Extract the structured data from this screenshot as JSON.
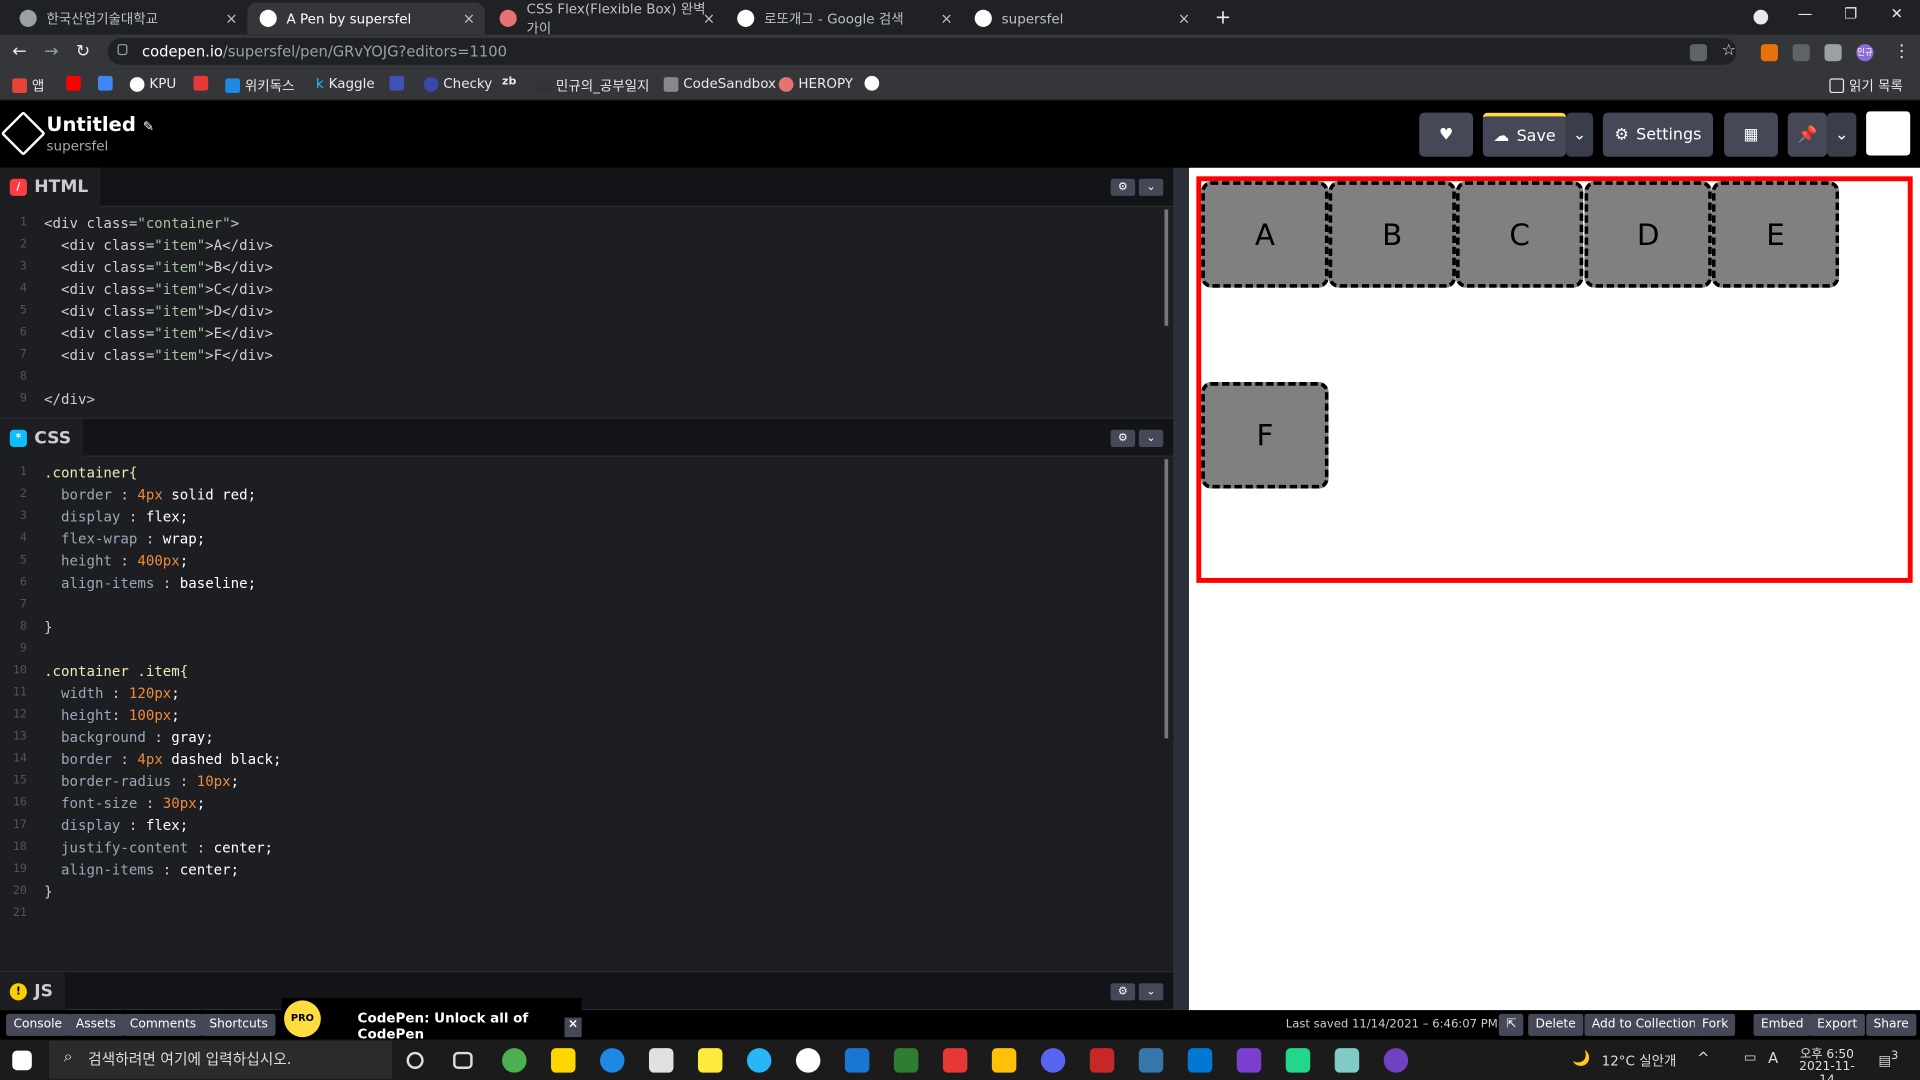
{
  "browser": {
    "tabs": [
      {
        "title": "한국산업기술대학교",
        "close": "×"
      },
      {
        "title": "A Pen by supersfel",
        "close": "×"
      },
      {
        "title": "CSS Flex(Flexible Box) 완벽 가이",
        "close": "×"
      },
      {
        "title": "로또개그 - Google 검색",
        "close": "×"
      },
      {
        "title": "supersfel",
        "close": "×"
      }
    ],
    "new_tab": "+",
    "url_host": "codepen.io",
    "url_path": "/supersfel/pen/GRvYOJG?editors=1100",
    "bookmarks": [
      "앱",
      "",
      "",
      "KPU",
      "",
      "위키독스",
      "Kaggle",
      "",
      "Checky",
      "zb",
      "민규의_공부일지",
      "CodeSandbox",
      "HEROPY",
      ""
    ],
    "reading_list": "읽기 목록",
    "profile_badge": "민규"
  },
  "codepen": {
    "title": "Untitled",
    "user": "supersfel",
    "save_label": "Save",
    "settings_label": "Settings",
    "panes": {
      "html_label": "HTML",
      "css_label": "CSS",
      "js_label": "JS"
    },
    "html_code": [
      "<div class=\"container\">",
      "  <div class=\"item\">A</div>",
      "  <div class=\"item\">B</div>",
      "  <div class=\"item\">C</div>",
      "  <div class=\"item\">D</div>",
      "  <div class=\"item\">E</div>",
      "  <div class=\"item\">F</div>",
      "",
      "</div>"
    ],
    "css_code": [
      ".container{",
      "  border : 4px solid red;",
      "  display : flex;",
      "  flex-wrap : wrap;",
      "  height : 400px;",
      "  align-items : baseline;",
      "",
      "}",
      "",
      ".container .item{",
      "  width : 120px;",
      "  height: 100px;",
      "  background : gray;",
      "  border : 4px dashed black;",
      "  border-radius : 10px;",
      "  font-size : 30px;",
      "  display : flex;",
      "  justify-content : center;",
      "  align-items : center;",
      "}",
      ""
    ],
    "preview_items": [
      "A",
      "B",
      "C",
      "D",
      "E",
      "F"
    ],
    "footer": {
      "console": "Console",
      "assets": "Assets",
      "comments": "Comments",
      "shortcuts": "Shortcuts",
      "promo_badge": "PRO",
      "promo_text": "CodePen: Unlock all of CodePen",
      "last_saved": "Last saved 11/14/2021 – 6:46:07 PM",
      "delete": "Delete",
      "add_to_collection": "Add to Collection",
      "fork": "Fork",
      "embed": "Embed",
      "export": "Export",
      "share": "Share"
    }
  },
  "taskbar": {
    "search_placeholder": "검색하려면 여기에 입력하십시오.",
    "weather": "12°C  실안개",
    "ime": "A",
    "time": "오후 6:50",
    "date": "2021-11-14",
    "notifications": "3"
  }
}
